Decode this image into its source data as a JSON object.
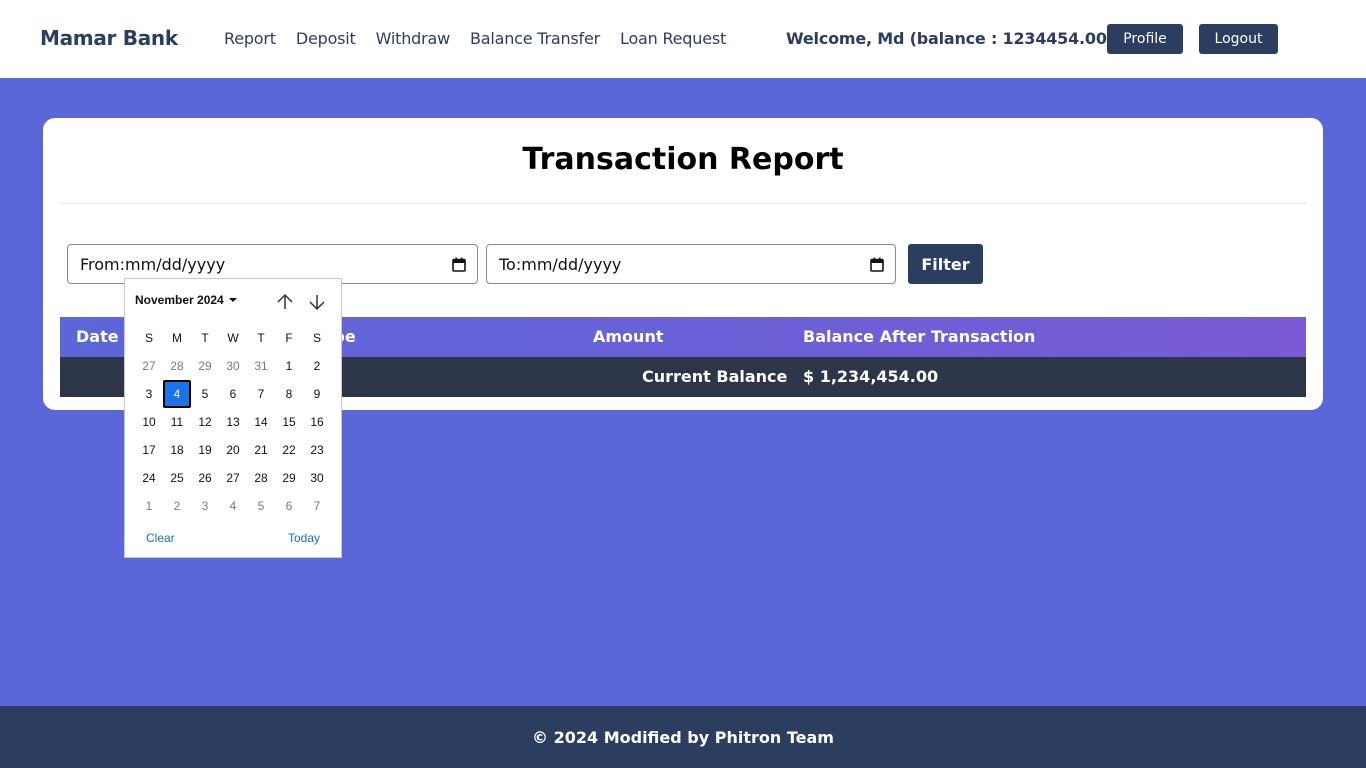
{
  "navbar": {
    "brand": "Mamar Bank",
    "links": [
      "Report",
      "Deposit",
      "Withdraw",
      "Balance Transfer",
      "Loan Request"
    ],
    "welcome": "Welcome, Md (balance : 1234454.00)",
    "profile_label": "Profile",
    "logout_label": "Logout"
  },
  "report": {
    "title": "Transaction Report",
    "from_value": "From:mm/dd/yyyy",
    "to_value": "To:mm/dd/yyyy",
    "filter_label": "Filter",
    "columns": [
      "Date",
      "Transaction Type",
      "Amount",
      "Balance After Transaction"
    ],
    "column_visible_type": "ype",
    "summary_label": "Current Balance",
    "summary_value": "$ 1,234,454.00"
  },
  "datepicker": {
    "month_label": "November 2024",
    "weekdays": [
      "S",
      "M",
      "T",
      "W",
      "T",
      "F",
      "S"
    ],
    "weeks": [
      [
        "27",
        "28",
        "29",
        "30",
        "31",
        "1",
        "2"
      ],
      [
        "3",
        "4",
        "5",
        "6",
        "7",
        "8",
        "9"
      ],
      [
        "10",
        "11",
        "12",
        "13",
        "14",
        "15",
        "16"
      ],
      [
        "17",
        "18",
        "19",
        "20",
        "21",
        "22",
        "23"
      ],
      [
        "24",
        "25",
        "26",
        "27",
        "28",
        "29",
        "30"
      ],
      [
        "1",
        "2",
        "3",
        "4",
        "5",
        "6",
        "7"
      ]
    ],
    "selected_day": "4",
    "clear_label": "Clear",
    "today_label": "Today",
    "icons": {
      "up": "arrow-up-icon",
      "down": "arrow-down-icon"
    }
  },
  "footer": {
    "text": "© 2024 Modified by Phitron Team"
  },
  "colors": {
    "primary": "#2c3e5f",
    "background": "#5b67d9",
    "selected": "#1a73e8"
  }
}
